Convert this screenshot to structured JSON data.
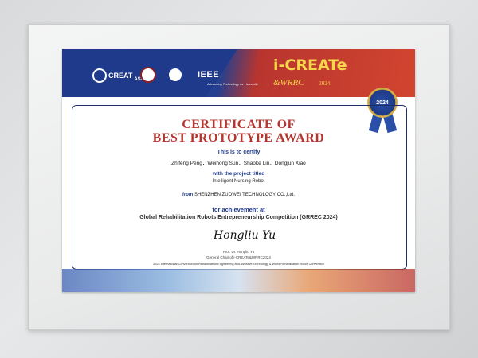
{
  "banner": {
    "logo_creat_text": "CREAT",
    "logo_asia_text": "ASIA",
    "ieee_name": "IEEE",
    "ieee_tagline": "Advancing Technology for Humanity",
    "event_name": "i-CREATe",
    "event_sub": "&WRRC",
    "event_year": "2024",
    "badge_year": "2024"
  },
  "certificate": {
    "title_line1": "CERTIFICATE OF",
    "title_line2": "BEST PROTOTYPE AWARD",
    "certify_text": "This is to certify",
    "recipients": "Zhifeng Peng，Weihong Sun，Shaoke Liu，Dongjun Xiao",
    "project_label": "with the project titled",
    "project_title": "Intelligent Nursing Robot",
    "from_label": "from",
    "organization": "SHENZHEN ZUOWEI TECHNOLOGY CO.,Ltd.",
    "achievement_label": "for achievement at",
    "competition": "Global Rehabilitation Robots Entrepreneurship Competition (GRREC 2024)",
    "signature_name": "Prof. Dr. Hongliu Yu",
    "signature_role": "General Chair of i-CREATe&WRRC2024",
    "convention": "2024 International Convention on Rehabilitation Engineering and Assistive Technology & World Rehabilitation Robot Convention"
  },
  "colors": {
    "title_red": "#b8352f",
    "navy": "#1f3a8a",
    "gold": "#f6d64a"
  }
}
